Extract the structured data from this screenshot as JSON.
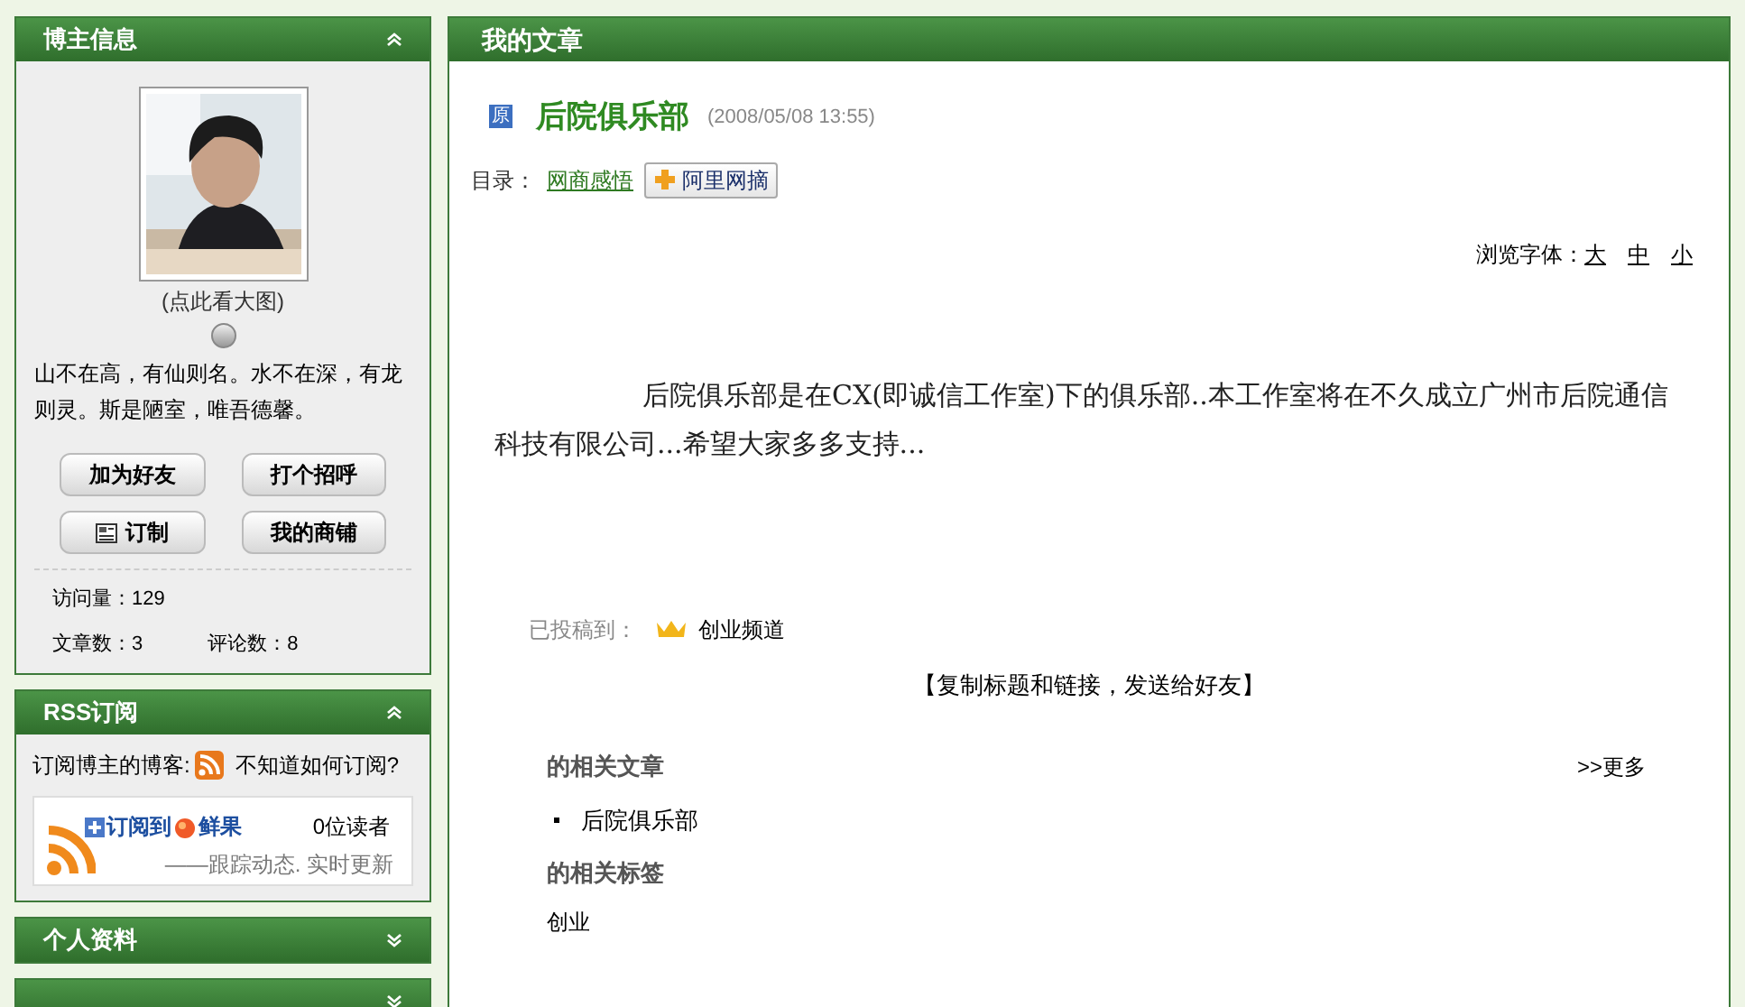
{
  "sidebar": {
    "panels": [
      {
        "kind": "profile",
        "title": "博主信息",
        "expanded": true,
        "photo_caption": "(点此看大图)",
        "motto": "山不在高，有仙则名。水不在深，有龙则灵。斯是陋室，唯吾德馨。",
        "buttons": [
          {
            "label": "加为好友",
            "kind": "plain"
          },
          {
            "label": "打个招呼",
            "kind": "plain"
          },
          {
            "label": "订制",
            "kind": "subscribe"
          },
          {
            "label": "我的商铺",
            "kind": "plain"
          }
        ],
        "visits": "访问量：129",
        "articles": "文章数：3",
        "comments": "评论数：8"
      },
      {
        "kind": "rss",
        "title": "RSS订阅",
        "expanded": true,
        "prompt": "订阅博主的博客:",
        "help_link": "不知道如何订阅?",
        "subscribe_link": "订阅到",
        "service": "鲜果",
        "readers": "0位读者",
        "tagline": "——跟踪动态. 实时更新"
      },
      {
        "title": "个人资料",
        "expanded": false
      },
      {
        "expanded": false
      }
    ]
  },
  "main": {
    "header": "我的文章",
    "badge": "原",
    "title": "后院俱乐部",
    "date": "(2008/05/08 13:55)",
    "category_label": "目录：",
    "category": "网商感悟",
    "bookmark_button": "阿里网摘",
    "font_size_label": "浏览字体：",
    "font_sizes": [
      "大",
      "中",
      "小"
    ],
    "body": "后院俱乐部是在CX(即诚信工作室)下的俱乐部..本工作室将在不久成立广州市后院通信科技有限公司...希望大家多多支持...",
    "submitted_label": "已投稿到：",
    "channel": "创业频道",
    "share": "【复制标题和链接，发送给好友】",
    "related_articles_title": "的相关文章",
    "more_link": ">>更多",
    "related_articles": [
      "后院俱乐部"
    ],
    "related_tags_title": "的相关标签",
    "tags": [
      "创业"
    ]
  }
}
